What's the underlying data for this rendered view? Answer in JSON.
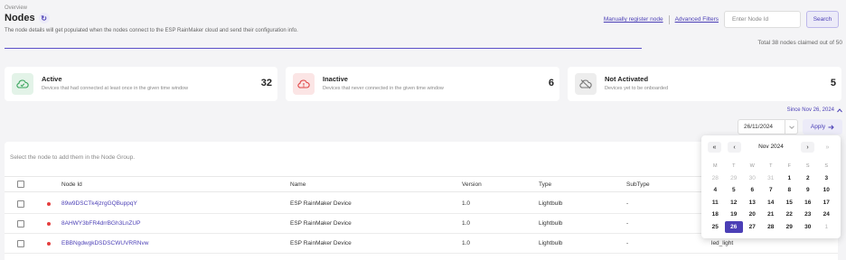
{
  "breadcrumb": "Overview",
  "page_title": "Nodes",
  "subtitle": "The node details will get populated when the nodes connect to the ESP RainMaker cloud and send their configuration info.",
  "actions": {
    "manual_register": "Manually register node",
    "advanced_filters": "Advanced Filters",
    "node_id_placeholder": "Enter Node Id",
    "search": "Search"
  },
  "total_claimed": "Total 38 nodes claimed out of 50",
  "cards": {
    "active": {
      "title": "Active",
      "desc": "Devices that had connected at least once in the given time window",
      "count": "32",
      "color": "#3aa55d"
    },
    "inactive": {
      "title": "Inactive",
      "desc": "Devices that never connected in the given time window",
      "count": "6",
      "color": "#e04848"
    },
    "not_activated": {
      "title": "Not Activated",
      "desc": "Devices yet to be onboarded",
      "count": "5",
      "color": "#777777"
    }
  },
  "since_label": "Since Nov 26, 2024",
  "date_value": "26/11/2024",
  "apply_label": "Apply",
  "table": {
    "hint": "Select the node to add them in the Node Group.",
    "columns": {
      "node_id": "Node Id",
      "name": "Name",
      "version": "Version",
      "type": "Type",
      "subtype": "SubType"
    },
    "rows": [
      {
        "node_id": "89w9DSCTk4jzrgGQBuppqY",
        "name": "ESP RainMaker Device",
        "version": "1.0",
        "type": "Lightbulb",
        "subtype": "-",
        "extra": ""
      },
      {
        "node_id": "8AHWY3bFR4drrBGh3LnZUP",
        "name": "ESP RainMaker Device",
        "version": "1.0",
        "type": "Lightbulb",
        "subtype": "-",
        "extra": ""
      },
      {
        "node_id": "EBBNgdwgkDSDSCWUVRRNvw",
        "name": "ESP RainMaker Device",
        "version": "1.0",
        "type": "Lightbulb",
        "subtype": "-",
        "extra": "led_light"
      }
    ]
  },
  "calendar": {
    "month_label": "Nov 2024",
    "nav": {
      "prev_year": "«",
      "prev_month": "‹",
      "next_month": "›",
      "next_year": "»"
    },
    "weekdays": [
      "M",
      "T",
      "W",
      "T",
      "F",
      "S",
      "S"
    ],
    "days": [
      {
        "d": "28",
        "muted": true
      },
      {
        "d": "29",
        "muted": true
      },
      {
        "d": "30",
        "muted": true
      },
      {
        "d": "31",
        "muted": true
      },
      {
        "d": "1"
      },
      {
        "d": "2"
      },
      {
        "d": "3"
      },
      {
        "d": "4"
      },
      {
        "d": "5"
      },
      {
        "d": "6"
      },
      {
        "d": "7"
      },
      {
        "d": "8"
      },
      {
        "d": "9"
      },
      {
        "d": "10"
      },
      {
        "d": "11"
      },
      {
        "d": "12"
      },
      {
        "d": "13"
      },
      {
        "d": "14"
      },
      {
        "d": "15"
      },
      {
        "d": "16"
      },
      {
        "d": "17"
      },
      {
        "d": "18"
      },
      {
        "d": "19"
      },
      {
        "d": "20"
      },
      {
        "d": "21"
      },
      {
        "d": "22"
      },
      {
        "d": "23"
      },
      {
        "d": "24"
      },
      {
        "d": "25"
      },
      {
        "d": "26",
        "selected": true
      },
      {
        "d": "27"
      },
      {
        "d": "28"
      },
      {
        "d": "29"
      },
      {
        "d": "30"
      },
      {
        "d": "1",
        "muted": true
      }
    ]
  },
  "accent_color": "#4b3fb6"
}
